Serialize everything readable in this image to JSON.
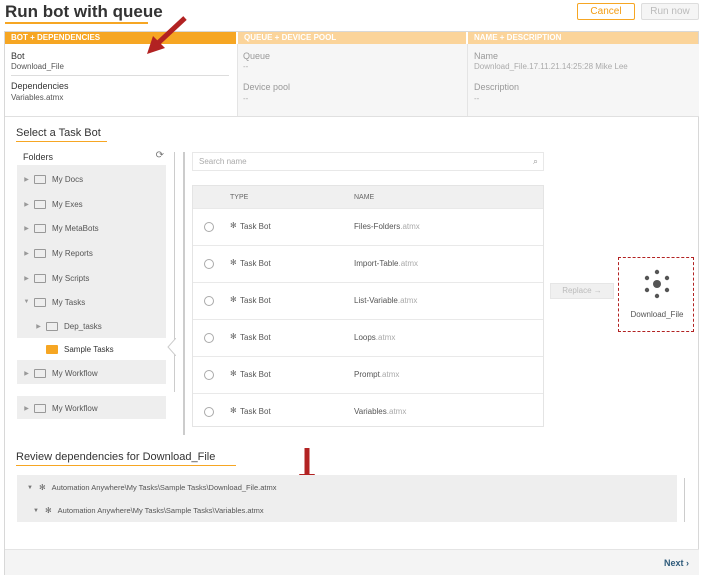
{
  "header": {
    "title": "Run bot with queue",
    "cancel_label": "Cancel",
    "run_label": "Run now"
  },
  "steps": [
    {
      "label": "BOT + DEPENDENCIES"
    },
    {
      "label": "QUEUE + DEVICE POOL"
    },
    {
      "label": "NAME + DESCRIPTION"
    }
  ],
  "summary": {
    "bot_label": "Bot",
    "bot_value": "Download_File",
    "deps_label": "Dependencies",
    "deps_value": "Variables.atmx",
    "queue_label": "Queue",
    "queue_value": "--",
    "pool_label": "Device pool",
    "pool_value": "--",
    "name_label": "Name",
    "name_value": "Download_File.17.11.21.14:25:28 Mike Lee",
    "desc_label": "Description",
    "desc_value": "--"
  },
  "select_section": {
    "title": "Select a Task Bot",
    "folders_label": "Folders",
    "tree": [
      {
        "label": "My Docs"
      },
      {
        "label": "My Exes"
      },
      {
        "label": "My MetaBots"
      },
      {
        "label": "My Reports"
      },
      {
        "label": "My Scripts"
      },
      {
        "label": "My Tasks"
      },
      {
        "label": "Dep_tasks"
      },
      {
        "label": "Sample Tasks"
      },
      {
        "label": "My Workflow"
      }
    ],
    "tree2": [
      {
        "label": "My Workflow"
      }
    ],
    "search_placeholder": "Search name",
    "columns": {
      "type": "TYPE",
      "name": "NAME"
    },
    "rows": [
      {
        "type": "Task Bot",
        "name": "Files-Folders",
        "ext": ".atmx"
      },
      {
        "type": "Task Bot",
        "name": "Import-Table",
        "ext": ".atmx"
      },
      {
        "type": "Task Bot",
        "name": "List-Variable",
        "ext": ".atmx"
      },
      {
        "type": "Task Bot",
        "name": "Loops",
        "ext": ".atmx"
      },
      {
        "type": "Task Bot",
        "name": "Prompt",
        "ext": ".atmx"
      },
      {
        "type": "Task Bot",
        "name": "Variables",
        "ext": ".atmx"
      }
    ],
    "replace_label": "Replace →",
    "selected_bot": "Download_File"
  },
  "review": {
    "title": "Review dependencies for Download_File",
    "items": [
      {
        "path": "Automation Anywhere\\My Tasks\\Sample Tasks\\Download_File.atmx"
      },
      {
        "path": "Automation Anywhere\\My Tasks\\Sample Tasks\\Variables.atmx"
      }
    ]
  },
  "footer": {
    "next_label": "Next ›"
  },
  "colors": {
    "accent": "#f6a623",
    "annotation_red": "#b22222",
    "link": "#2e5a7a"
  },
  "icons": [
    "refresh-icon",
    "search-icon",
    "folder-icon",
    "bot-icon",
    "caret-right-icon",
    "caret-down-icon",
    "red-arrow-icon",
    "dots-spinner-icon"
  ]
}
